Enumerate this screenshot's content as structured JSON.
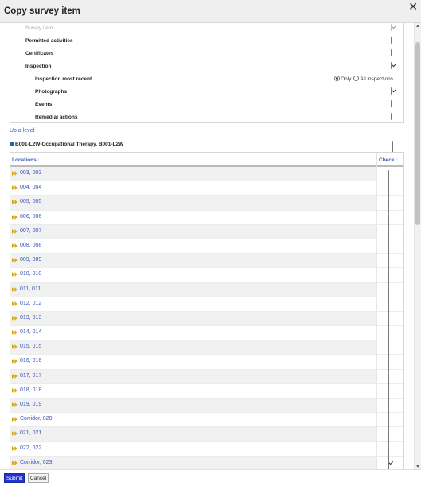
{
  "dialog": {
    "title": "Copy survey item",
    "close_icon": "close-icon"
  },
  "options": [
    {
      "label": "Survey item",
      "checked": true,
      "disabled": true,
      "indent": 1
    },
    {
      "label": "Permitted activities",
      "checked": false,
      "disabled": false,
      "indent": 1
    },
    {
      "label": "Certificates",
      "checked": false,
      "disabled": false,
      "indent": 1
    },
    {
      "label": "Inspection",
      "checked": true,
      "disabled": false,
      "indent": 1
    },
    {
      "label": "Inspection most recent",
      "indent": 2,
      "radios": [
        {
          "label": "Only",
          "selected": true
        },
        {
          "label": "All inspections",
          "selected": false
        }
      ]
    },
    {
      "label": "Photographs",
      "checked": true,
      "disabled": false,
      "indent": 2
    },
    {
      "label": "Events",
      "checked": false,
      "disabled": false,
      "indent": 2
    },
    {
      "label": "Remedial actions",
      "checked": false,
      "disabled": false,
      "indent": 2
    }
  ],
  "up_level_label": "Up a level",
  "current_item": {
    "label": "B001-L2W-Occupational Therapy, B001-L2W",
    "checked": false,
    "marker_color": "#2a5db0"
  },
  "table": {
    "col_locations": "Locations",
    "col_check": "Check",
    "sort_glyph": "↕",
    "rows": [
      {
        "label": "003, 003",
        "checked": false
      },
      {
        "label": "004, 004",
        "checked": false
      },
      {
        "label": "005, 005",
        "checked": false
      },
      {
        "label": "006, 006",
        "checked": false
      },
      {
        "label": "007, 007",
        "checked": false
      },
      {
        "label": "008, 008",
        "checked": false
      },
      {
        "label": "009, 009",
        "checked": false
      },
      {
        "label": "010, 010",
        "checked": false
      },
      {
        "label": "011, 011",
        "checked": false
      },
      {
        "label": "012, 012",
        "checked": false
      },
      {
        "label": "013, 013",
        "checked": false
      },
      {
        "label": "014, 014",
        "checked": false
      },
      {
        "label": "015, 015",
        "checked": false
      },
      {
        "label": "016, 016",
        "checked": false
      },
      {
        "label": "017, 017",
        "checked": false
      },
      {
        "label": "018, 018",
        "checked": false
      },
      {
        "label": "019, 019",
        "checked": false
      },
      {
        "label": "Corridor, 020",
        "checked": false
      },
      {
        "label": "021, 021",
        "checked": false
      },
      {
        "label": "022, 022",
        "checked": false
      },
      {
        "label": "Corridor, 023",
        "checked": true
      }
    ]
  },
  "footer": {
    "submit_label": "Submit",
    "cancel_label": "Cancel"
  },
  "colors": {
    "accent": "#3a56b8",
    "submit": "#2233cc",
    "chevron": "#d9a400"
  }
}
